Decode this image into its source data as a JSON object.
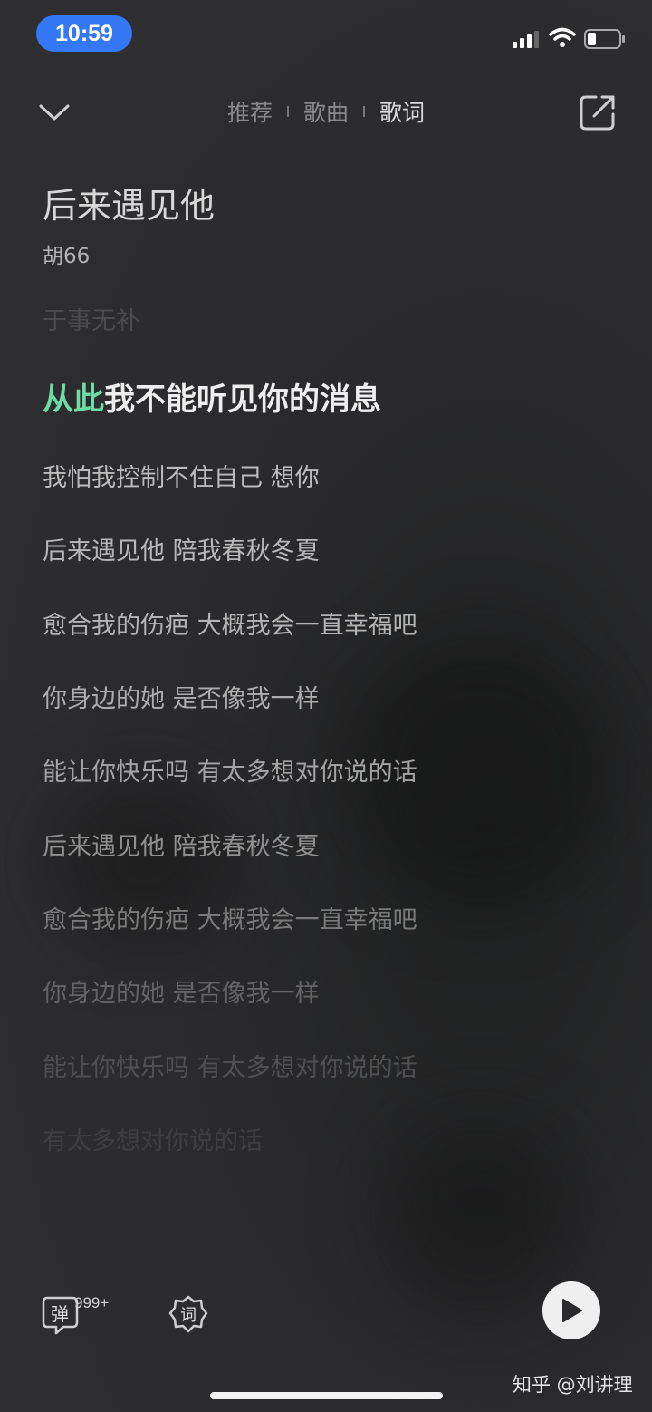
{
  "status_bar": {
    "time": "10:59"
  },
  "nav": {
    "tabs": [
      {
        "label": "推荐",
        "active": false
      },
      {
        "label": "歌曲",
        "active": false
      },
      {
        "label": "歌词",
        "active": true
      }
    ]
  },
  "song": {
    "title": "后来遇见他",
    "artist": "胡66"
  },
  "lyrics": {
    "previous": "于事无补",
    "current_sung": "从此",
    "current_rest": "我不能听见你的消息",
    "upcoming": [
      "我怕我控制不住自己 想你",
      "后来遇见他 陪我春秋冬夏",
      "愈合我的伤疤 大概我会一直幸福吧",
      "你身边的她 是否像我一样",
      "能让你快乐吗 有太多想对你说的话",
      "后来遇见他 陪我春秋冬夏",
      "愈合我的伤疤 大概我会一直幸福吧",
      "你身边的她 是否像我一样",
      "能让你快乐吗 有太多想对你说的话",
      "有太多想对你说的话"
    ]
  },
  "controls": {
    "danmaku_label": "弹",
    "danmaku_count": "999+",
    "lyric_mode_label": "词"
  },
  "watermark": "知乎 @刘讲理",
  "colors": {
    "accent": "#6fdba7",
    "status_time_bg": "#3478f6"
  },
  "icons": {
    "back": "chevron-down-icon",
    "share": "share-icon",
    "play": "play-icon"
  }
}
